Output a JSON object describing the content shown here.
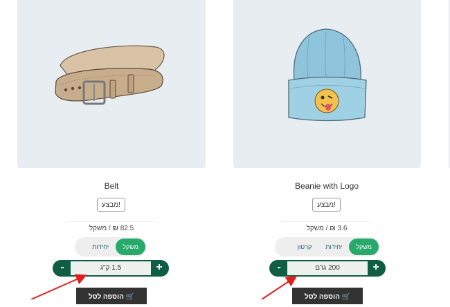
{
  "products": [
    {
      "name": "Belt",
      "image_icon": "belt-illustration",
      "sale_badge": "מבצע!",
      "price": "82.5 ₪ / משקל",
      "units": [
        {
          "label": "יחידות",
          "active": false
        },
        {
          "label": "משקל",
          "active": true
        }
      ],
      "quantity": "1.5 ק\"ג",
      "minus": "-",
      "plus": "+",
      "add_to_cart": "הוספה לסל"
    },
    {
      "name": "Beanie with Logo",
      "image_icon": "beanie-illustration",
      "sale_badge": "מבצע!",
      "price": "3.6 ₪ / משקל",
      "units": [
        {
          "label": "קרטון",
          "active": false
        },
        {
          "label": "יחידות",
          "active": false
        },
        {
          "label": "משקל",
          "active": true
        }
      ],
      "quantity": "200 גרם",
      "minus": "-",
      "plus": "+",
      "add_to_cart": "הוספה לסל"
    }
  ],
  "colors": {
    "accent_green": "#26a96b",
    "dark_green": "#0f5d43",
    "card_bg": "#e8edf2",
    "arrow_red": "#e02020"
  }
}
